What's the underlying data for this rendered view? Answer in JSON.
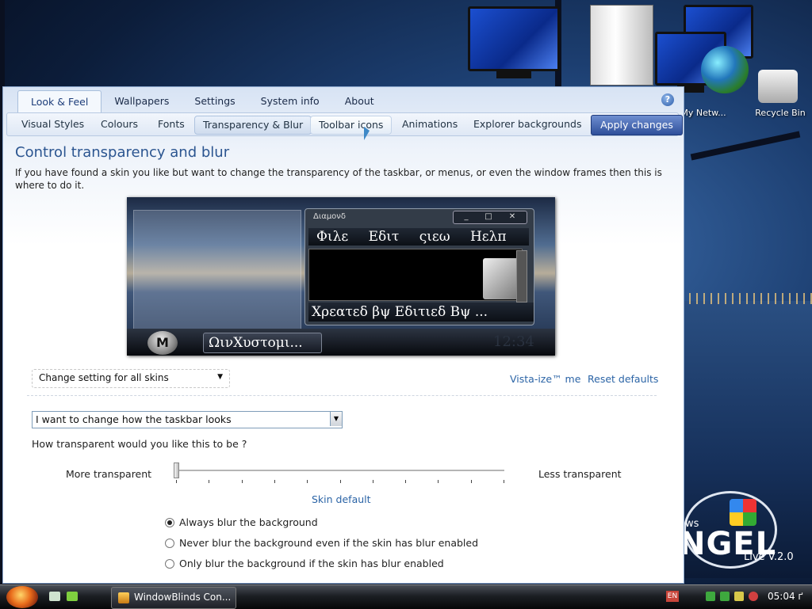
{
  "desktop": {
    "icons": [
      {
        "label": "My Netw..."
      },
      {
        "label": "Recycle Bin"
      }
    ],
    "brand": {
      "ws": "ows",
      "name": "NGEL",
      "version": "Live V.2.0"
    }
  },
  "app": {
    "main_tabs": [
      {
        "label": "Look & Feel",
        "active": true
      },
      {
        "label": "Wallpapers"
      },
      {
        "label": "Settings"
      },
      {
        "label": "System info"
      },
      {
        "label": "About"
      }
    ],
    "help_icon": "?",
    "sub_tabs": [
      {
        "label": "Visual Styles"
      },
      {
        "label": "Colours"
      },
      {
        "label": "Fonts"
      },
      {
        "label": "Transparency & Blur",
        "selected": true
      },
      {
        "label": "Toolbar icons",
        "hover": true
      },
      {
        "label": "Animations"
      },
      {
        "label": "Explorer backgrounds"
      }
    ],
    "apply_button": "Apply changes",
    "title": "Control transparency and blur",
    "description": "If you have found a skin you like but want to change the transparency of the taskbar, or menus, or even the window frames then this is where to do it.",
    "preview": {
      "window_title": "Διαμονδ",
      "menu": [
        "Φιλε",
        "Εδιτ",
        "ςιεω",
        "Ηελπ"
      ],
      "status_text": "Χρεατεδ βψ Εδιτιεδ Βψ ...",
      "orb_letter": "M",
      "taskbar_button": "ΩινΧυστομι...",
      "clock": "12:34",
      "buttons": [
        "_",
        "□",
        "✕"
      ]
    },
    "skin_scope": {
      "selected": "Change setting for all skins",
      "arrow": "▼"
    },
    "links": {
      "vista": "Vista-ize™ me",
      "reset": "Reset defaults"
    },
    "target": {
      "selected": "I want to change how the taskbar looks",
      "arrow": "▼"
    },
    "question": "How transparent would you like this to be ?",
    "slider": {
      "min_label": "More transparent",
      "max_label": "Less transparent",
      "value": 0,
      "default_link": "Skin default"
    },
    "blur_options": [
      {
        "label": "Always blur the background",
        "checked": true
      },
      {
        "label": "Never blur the background even if the skin has blur enabled",
        "checked": false
      },
      {
        "label": "Only blur the background if the skin has blur enabled",
        "checked": false
      }
    ]
  },
  "taskbar": {
    "task_button": "WindowBlinds Con...",
    "language": "EN",
    "clock": "05:04 ґ"
  },
  "colors": {
    "accent": "#2b64a6",
    "title": "#2b5590",
    "apply_bg": "#3d5ea8"
  }
}
